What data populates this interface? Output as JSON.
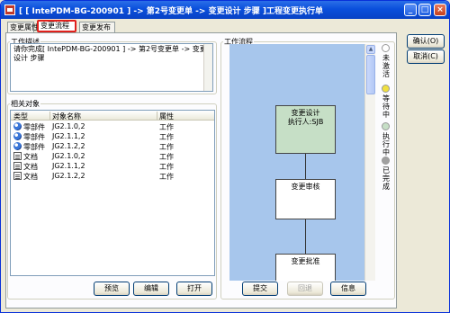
{
  "window": {
    "title": "[ [ IntePDM-BG-200901 ] -> 第2号变更单 -> 变更设计 步骤 ]工程变更执行单",
    "minimize_glyph": "_",
    "maximize_glyph": "□",
    "close_glyph": "×"
  },
  "tabs": [
    "变更属性",
    "变更流程",
    "变更发布"
  ],
  "active_tab_index": 1,
  "description": {
    "legend": "工作描述",
    "text": "请你完成[ IntePDM-BG-200901 ] -> 第2号变更单 -> 变更设计 步骤"
  },
  "objects": {
    "legend": "相关对象",
    "columns": [
      "类型",
      "对象名称",
      "属性"
    ],
    "rows": [
      {
        "icon": "part-icon",
        "type": "零部件",
        "name": "JG2.1.0,2",
        "attr": "工作"
      },
      {
        "icon": "part-icon",
        "type": "零部件",
        "name": "JG2.1.1,2",
        "attr": "工作"
      },
      {
        "icon": "part-icon",
        "type": "零部件",
        "name": "JG2.1.2,2",
        "attr": "工作"
      },
      {
        "icon": "document-icon",
        "type": "文档",
        "name": "JG2.1.0,2",
        "attr": "工作"
      },
      {
        "icon": "document-icon",
        "type": "文档",
        "name": "JG2.1.1,2",
        "attr": "工作"
      },
      {
        "icon": "document-icon",
        "type": "文档",
        "name": "JG2.1.2,2",
        "attr": "工作"
      }
    ],
    "buttons": {
      "preview": "预览",
      "edit": "编辑",
      "open": "打开"
    }
  },
  "workflow": {
    "legend": "工作流程",
    "nodes": [
      {
        "label": "变更设计",
        "sub": "执行人:SJB",
        "state": "active"
      },
      {
        "label": "变更审核",
        "sub": "",
        "state": "pending"
      },
      {
        "label": "变更批准",
        "sub": "",
        "state": "pending"
      }
    ],
    "status_legend": [
      {
        "label": "未激活",
        "color": "#ffffff"
      },
      {
        "label": "等待中",
        "color": "#f0e040"
      },
      {
        "label": "执行中",
        "color": "#c6dfc6"
      },
      {
        "label": "已完成",
        "color": "#a0a0a0"
      }
    ],
    "buttons": {
      "submit": "提交",
      "rollback": "回退",
      "info": "信息"
    }
  },
  "side_buttons": {
    "ok": "确认(O)",
    "cancel": "取消(C)"
  },
  "colors": {
    "titlebar": "#0a4fdc",
    "active_node": "#c6dfc6",
    "flow_background": "#a7c6ec",
    "active_tab_border": "#e0201c"
  }
}
